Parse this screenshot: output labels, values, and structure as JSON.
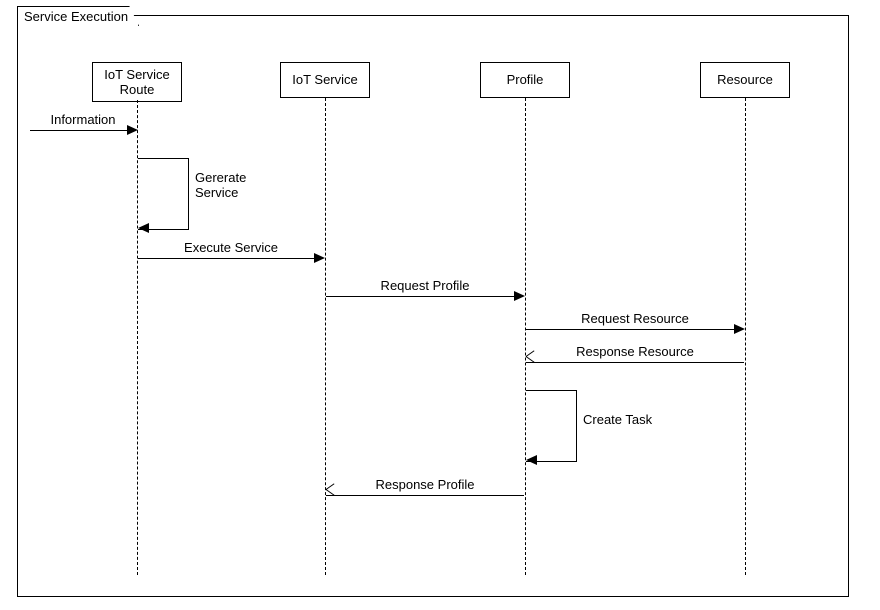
{
  "frame": {
    "title": "Service Execution"
  },
  "participants": {
    "p1": "IoT Service\nRoute",
    "p2": "IoT Service",
    "p3": "Profile",
    "p4": "Resource"
  },
  "messages": {
    "m0": "Information",
    "m1": "Gererate\nService",
    "m2": "Execute Service",
    "m3": "Request Profile",
    "m4": "Request Resource",
    "m5": "Response Resource",
    "m6": "Create Task",
    "m7": "Response Profile"
  },
  "chart_data": {
    "type": "sequence-diagram",
    "frame": "Service Execution",
    "participants": [
      "IoT Service Route",
      "IoT Service",
      "Profile",
      "Resource"
    ],
    "steps": [
      {
        "from": "(external)",
        "to": "IoT Service Route",
        "label": "Information",
        "kind": "found-sync"
      },
      {
        "from": "IoT Service Route",
        "to": "IoT Service Route",
        "label": "Gererate Service",
        "kind": "self-sync"
      },
      {
        "from": "IoT Service Route",
        "to": "IoT Service",
        "label": "Execute Service",
        "kind": "sync"
      },
      {
        "from": "IoT Service",
        "to": "Profile",
        "label": "Request Profile",
        "kind": "sync"
      },
      {
        "from": "Profile",
        "to": "Resource",
        "label": "Request Resource",
        "kind": "sync"
      },
      {
        "from": "Resource",
        "to": "Profile",
        "label": "Response Resource",
        "kind": "return"
      },
      {
        "from": "Profile",
        "to": "Profile",
        "label": "Create Task",
        "kind": "self-sync"
      },
      {
        "from": "Profile",
        "to": "IoT Service",
        "label": "Response Profile",
        "kind": "return"
      }
    ]
  }
}
